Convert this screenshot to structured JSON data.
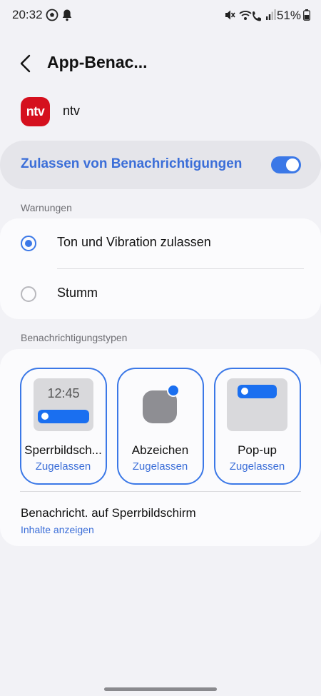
{
  "status_bar": {
    "time": "20:32",
    "battery": "51%",
    "icons": [
      "soccer-ball-icon",
      "bell-icon",
      "mute-icon",
      "wifi-calling-icon",
      "signal-icon",
      "battery-icon"
    ]
  },
  "header": {
    "title": "App-Benac..."
  },
  "app": {
    "logo_text": "ntv",
    "name": "ntv",
    "logo_color": "#d5101e"
  },
  "allow": {
    "label": "Zulassen von Benachrichtigungen",
    "enabled": true
  },
  "warnings": {
    "header": "Warnungen",
    "options": [
      {
        "label": "Ton und Vibration zulassen",
        "selected": true
      },
      {
        "label": "Stumm",
        "selected": false
      }
    ]
  },
  "types": {
    "header": "Benachrichtigungstypen",
    "tiles": [
      {
        "label": "Sperrbildsch...",
        "status": "Zugelassen",
        "preview_clock": "12:45"
      },
      {
        "label": "Abzeichen",
        "status": "Zugelassen"
      },
      {
        "label": "Pop-up",
        "status": "Zugelassen"
      }
    ],
    "lockscreen": {
      "title": "Benachricht. auf Sperrbildschirm",
      "value": "Inhalte anzeigen"
    }
  },
  "colors": {
    "accent": "#3b78e7",
    "background": "#f2f2f6",
    "card": "#fbfbfd"
  }
}
